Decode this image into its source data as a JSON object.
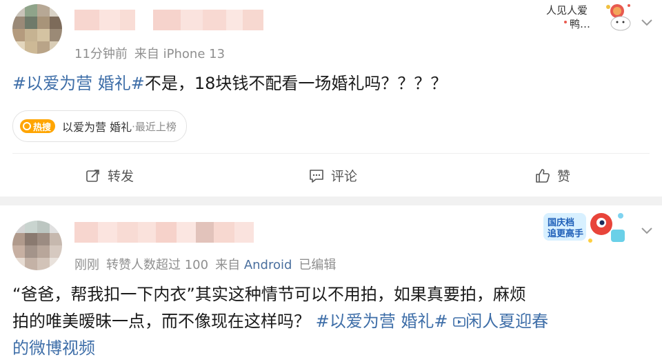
{
  "post1": {
    "meta_time": "11分钟前",
    "meta_source_prefix": "来自",
    "meta_source": "iPhone 13",
    "text_tag": "#以爱为营 婚礼#",
    "text_body": "不是，18块钱不配看一场婚礼吗？？？？",
    "hot_badge": "热搜",
    "hot_topic": "以爱为营 婚礼",
    "hot_suffix": "·最近上榜",
    "sticker_text": "人见人爱 鸭…",
    "actions": {
      "repost": "转发",
      "comment": "评论",
      "like": "赞"
    }
  },
  "post2": {
    "meta_time": "刚刚",
    "meta_stat": "转赞人数超过 100",
    "meta_source_prefix": "来自",
    "meta_source": "Android",
    "meta_edited": "已编辑",
    "text_line1": "“爸爸，帮我扣一下内衣”其实这种情节可以不用拍，如果真要拍，麻烦",
    "text_line2_plain": "拍的唯美暧昧一点，而不像现在这样吗？ ",
    "text_line2_tag": "#以爱为营 婚礼#",
    "text_line2_video_icon": "video-icon",
    "text_line2_link": "闲人夏迎春",
    "text_line3_link": "的微博视频",
    "sticker_text": "国庆档 追更高手"
  },
  "colors": {
    "link": "#3e6ea8",
    "meta": "#8f8f8f",
    "hot_badge": "#ffa500",
    "separator": "#f1f1f1"
  }
}
